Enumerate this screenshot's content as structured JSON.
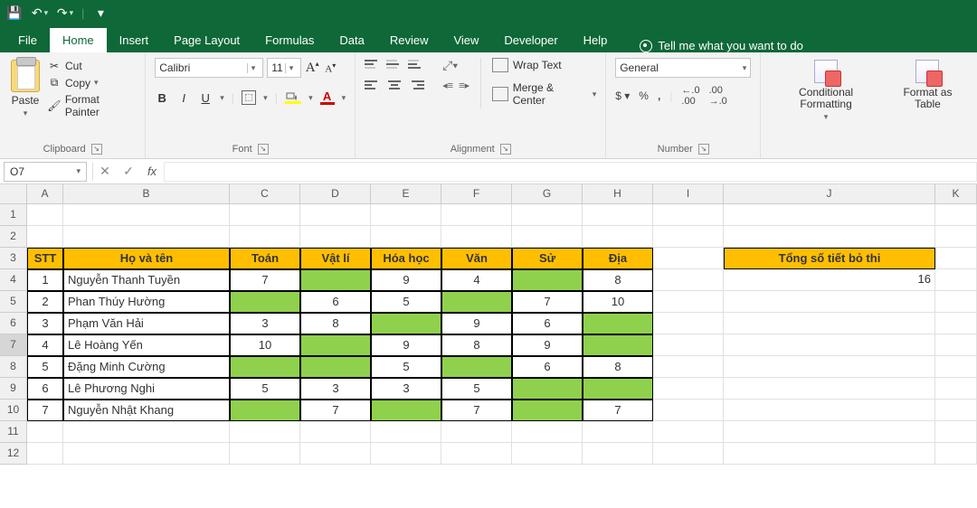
{
  "qat": {
    "save": "💾",
    "undo": "↶",
    "redo": "↷",
    "more": "⋯"
  },
  "tabs": [
    "File",
    "Home",
    "Insert",
    "Page Layout",
    "Formulas",
    "Data",
    "Review",
    "View",
    "Developer",
    "Help"
  ],
  "active_tab": 1,
  "tellme": "Tell me what you want to do",
  "ribbon": {
    "clipboard": {
      "label": "Clipboard",
      "paste": "Paste",
      "cut": "Cut",
      "copy": "Copy",
      "painter": "Format Painter"
    },
    "font": {
      "label": "Font",
      "name": "Calibri",
      "size": "11",
      "bold": "B",
      "italic": "I",
      "underline": "U",
      "grow": "A",
      "shrink": "A"
    },
    "alignment": {
      "label": "Alignment",
      "wrap": "Wrap Text",
      "merge": "Merge & Center"
    },
    "number": {
      "label": "Number",
      "format": "General",
      "currency": "$",
      "percent": "%",
      "comma": ",",
      "inc": ".0",
      "dec": ".00"
    },
    "styles": {
      "cond": "Conditional Formatting",
      "table": "Format as Table"
    }
  },
  "namebox": "O7",
  "columns": [
    "A",
    "B",
    "C",
    "D",
    "E",
    "F",
    "G",
    "H",
    "I",
    "J",
    "K"
  ],
  "rows": [
    1,
    2,
    3,
    4,
    5,
    6,
    7,
    8,
    9,
    10,
    11,
    12
  ],
  "selected_row": 7,
  "table": {
    "headers": [
      "STT",
      "Họ và tên",
      "Toán",
      "Vật lí",
      "Hóa học",
      "Văn",
      "Sử",
      "Địa"
    ],
    "rows": [
      {
        "stt": 1,
        "name": "Nguyễn Thanh Tuyền",
        "scores": [
          "7",
          "",
          "9",
          "4",
          "",
          "8"
        ],
        "green": [
          1,
          4
        ]
      },
      {
        "stt": 2,
        "name": "Phan Thúy Hường",
        "scores": [
          "",
          "6",
          "5",
          "",
          "7",
          "10"
        ],
        "green": [
          0,
          3
        ]
      },
      {
        "stt": 3,
        "name": "Phạm Văn Hải",
        "scores": [
          "3",
          "8",
          "",
          "9",
          "6",
          ""
        ],
        "green": [
          2,
          5
        ]
      },
      {
        "stt": 4,
        "name": "Lê Hoàng Yến",
        "scores": [
          "10",
          "",
          "9",
          "8",
          "9",
          ""
        ],
        "green": [
          1,
          5
        ]
      },
      {
        "stt": 5,
        "name": "Đặng Minh Cường",
        "scores": [
          "",
          "",
          "5",
          "",
          "6",
          "8"
        ],
        "green": [
          0,
          1,
          3
        ]
      },
      {
        "stt": 6,
        "name": "Lê Phương Nghi",
        "scores": [
          "5",
          "3",
          "3",
          "5",
          "",
          ""
        ],
        "green": [
          4,
          5
        ]
      },
      {
        "stt": 7,
        "name": "Nguyễn Nhật Khang",
        "scores": [
          "",
          "7",
          "",
          "7",
          "",
          "7"
        ],
        "green": [
          0,
          2,
          4
        ]
      }
    ]
  },
  "summary": {
    "label": "Tổng số tiết bỏ thi",
    "value": 16
  },
  "chart_data": {
    "type": "table",
    "title": "Student subject scores (blank = skipped exam)",
    "columns": [
      "STT",
      "Họ và tên",
      "Toán",
      "Vật lí",
      "Hóa học",
      "Văn",
      "Sử",
      "Địa"
    ],
    "rows": [
      [
        1,
        "Nguyễn Thanh Tuyền",
        7,
        null,
        9,
        4,
        null,
        8
      ],
      [
        2,
        "Phan Thúy Hường",
        null,
        6,
        5,
        null,
        7,
        10
      ],
      [
        3,
        "Phạm Văn Hải",
        3,
        8,
        null,
        9,
        6,
        null
      ],
      [
        4,
        "Lê Hoàng Yến",
        10,
        null,
        9,
        8,
        9,
        null
      ],
      [
        5,
        "Đặng Minh Cường",
        null,
        null,
        5,
        null,
        6,
        8
      ],
      [
        6,
        "Lê Phương Nghi",
        5,
        3,
        3,
        5,
        null,
        null
      ],
      [
        7,
        "Nguyễn Nhật Khang",
        null,
        7,
        null,
        7,
        null,
        7
      ]
    ],
    "summary": {
      "Tổng số tiết bỏ thi": 16
    }
  }
}
